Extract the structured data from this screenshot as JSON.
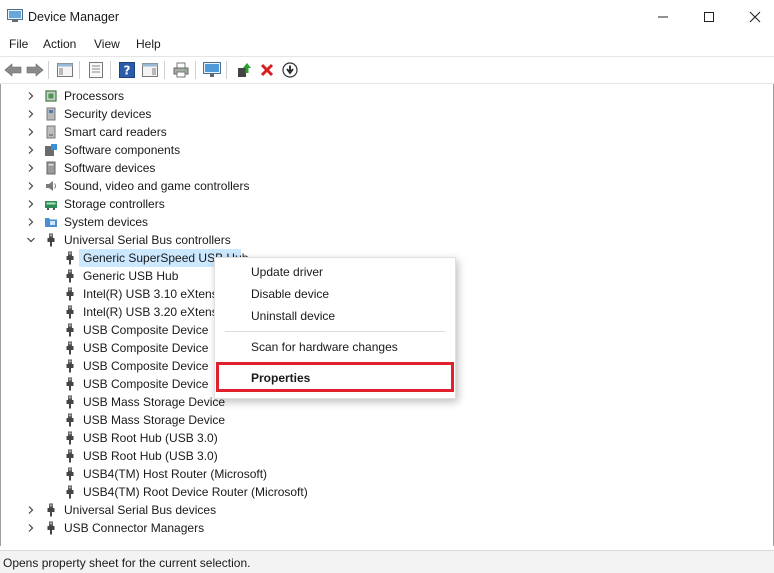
{
  "window": {
    "title": "Device Manager",
    "minimize_glyph": "—",
    "maximize_glyph": "☐",
    "close_glyph": "✕"
  },
  "menu": [
    "File",
    "Action",
    "View",
    "Help"
  ],
  "toolbar_icons": [
    "back-arrow-icon",
    "forward-arrow-icon",
    "show-hide-tree-icon",
    "properties-icon",
    "help-icon",
    "action-pane-icon",
    "print-icon",
    "scan-hardware-icon",
    "update-driver-icon",
    "uninstall-icon",
    "disable-icon"
  ],
  "tree": {
    "categories_top": [
      {
        "label": "Processors",
        "icon": "processor-icon"
      },
      {
        "label": "Security devices",
        "icon": "security-icon"
      },
      {
        "label": "Smart card readers",
        "icon": "smartcard-icon"
      },
      {
        "label": "Software components",
        "icon": "software-component-icon"
      },
      {
        "label": "Software devices",
        "icon": "software-device-icon"
      },
      {
        "label": "Sound, video and game controllers",
        "icon": "speaker-icon"
      },
      {
        "label": "Storage controllers",
        "icon": "storage-icon"
      },
      {
        "label": "System devices",
        "icon": "system-folder-icon"
      }
    ],
    "expanded_category": "Universal Serial Bus controllers",
    "usb_children": [
      "Generic SuperSpeed USB Hub",
      "Generic USB Hub",
      "Intel(R) USB 3.10 eXtensible Host Controller - 1.10 (Microsoft)",
      "Intel(R) USB 3.20 eXtensible Host Controller - 1.20 (Microsoft)",
      "USB Composite Device",
      "USB Composite Device",
      "USB Composite Device",
      "USB Composite Device",
      "USB Mass Storage Device",
      "USB Mass Storage Device",
      "USB Root Hub (USB 3.0)",
      "USB Root Hub (USB 3.0)",
      "USB4(TM) Host Router (Microsoft)",
      "USB4(TM) Root Device Router (Microsoft)"
    ],
    "usb_children_visible": [
      "Generic SuperSpeed USB Hub",
      "Generic USB Hub",
      "Intel(R) USB 3.10 eXtensib",
      "Intel(R) USB 3.20 eXtensib",
      "USB Composite Device",
      "USB Composite Device",
      "USB Composite Device",
      "USB Composite Device",
      "USB Mass Storage Device",
      "USB Mass Storage Device",
      "USB Root Hub (USB 3.0)",
      "USB Root Hub (USB 3.0)",
      "USB4(TM) Host Router (Microsoft)",
      "USB4(TM) Root Device Router (Microsoft)"
    ],
    "categories_bottom": [
      {
        "label": "Universal Serial Bus devices",
        "icon": "usb-plug-icon"
      },
      {
        "label": "USB Connector Managers",
        "icon": "usb-plug-icon"
      }
    ]
  },
  "context_menu": {
    "items": [
      "Update driver",
      "Disable device",
      "Uninstall device",
      "Scan for hardware changes",
      "Properties"
    ],
    "default_item": "Properties"
  },
  "status": "Opens property sheet for the current selection.",
  "colors": {
    "selection": "#cce8ff",
    "highlight_box": "#e0202a"
  }
}
